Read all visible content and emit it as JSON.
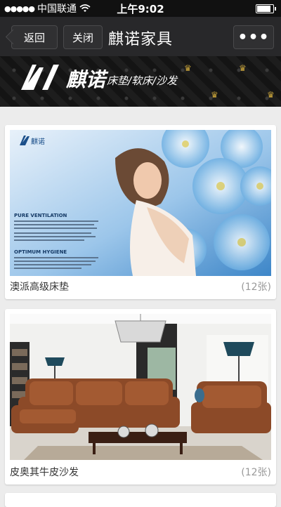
{
  "status": {
    "carrier": "中国联通",
    "time": "上午9:02"
  },
  "nav": {
    "back_label": "返回",
    "close_label": "关闭",
    "title": "麒诺家具",
    "more_label": "•••"
  },
  "brand": {
    "name": "麒诺",
    "tagline": "床垫/软床/沙发"
  },
  "albums": [
    {
      "name": "澳派高级床垫",
      "count": "(12张)",
      "photo_text": {
        "logo": "麒诺",
        "heading1": "PURE VENTILATION",
        "heading2": "OPTIMUM HYGIENE"
      }
    },
    {
      "name": "皮奥其牛皮沙发",
      "count": "(12张)"
    }
  ],
  "colors": {
    "navbar": "#28282a",
    "statusbar": "#111111",
    "background": "#ececec",
    "count_text": "#999999",
    "crown": "#c9a43a"
  }
}
